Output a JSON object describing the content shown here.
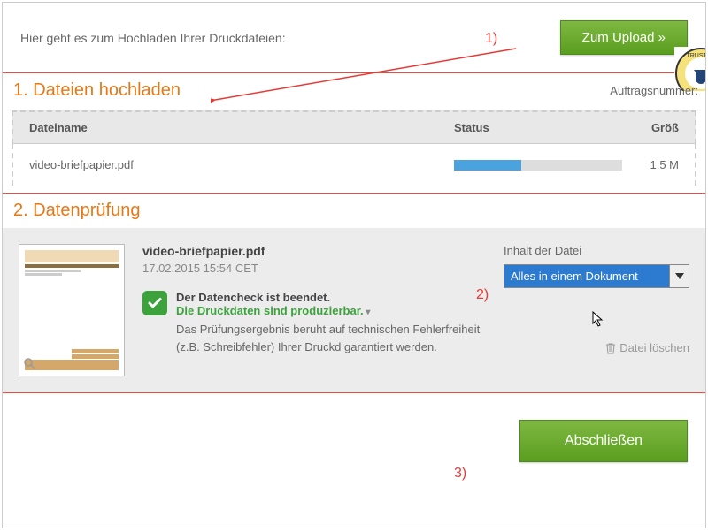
{
  "top": {
    "text": "Hier geht es zum Hochladen Ihrer Druckdateien:",
    "upload_btn": "Zum Upload »"
  },
  "section1": {
    "title": "1. Dateien hochladen",
    "order_label": "Auftragsnummer:",
    "columns": {
      "name": "Dateiname",
      "status": "Status",
      "size": "Größ"
    },
    "file": {
      "name": "video-briefpapier.pdf",
      "size": "1.5 M"
    }
  },
  "section2": {
    "title": "2. Datenprüfung",
    "file_name": "video-briefpapier.pdf",
    "file_date": "17.02.2015 15:54 CET",
    "check_line1": "Der Datencheck ist beendet.",
    "check_line2": "Die Druckdaten sind produzierbar.",
    "check_line3": "Das Prüfungsergebnis beruht auf technischen Fehlerfreiheit (z.B. Schreibfehler) Ihrer Druckd garantiert werden.",
    "right_label": "Inhalt der Datei",
    "select_value": "Alles in einem Dokument",
    "delete_label": "Datei löschen"
  },
  "footer": {
    "finish_btn": "Abschließen"
  },
  "annotations": {
    "a1": "1)",
    "a2": "2)",
    "a3": "3)"
  }
}
